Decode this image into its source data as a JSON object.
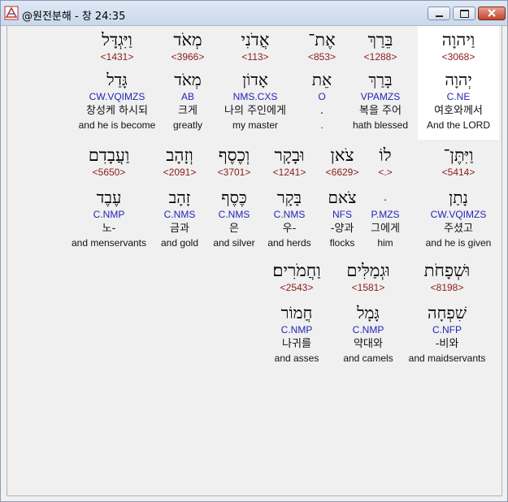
{
  "window": {
    "title": "@원전분해 - 창 24:35"
  },
  "rows": [
    [
      {
        "heb": "וַיהוָה",
        "strong": "<3068>",
        "lemma": "יְהוָה",
        "parse": "C.NE",
        "kor": "여호와께서",
        "eng": "And the LORD",
        "highlight": true
      },
      {
        "heb": "בֵּרַךְ",
        "strong": "<1288>",
        "lemma": "בָּרַךְ",
        "parse": "VPAMZS",
        "kor": "복을 주어",
        "eng": "hath blessed"
      },
      {
        "heb": "אֶת־",
        "strong": "<853>",
        "lemma": "אֵת",
        "parse": "O",
        "kor": ".",
        "eng": "."
      },
      {
        "heb": "אֲדֹנִי",
        "strong": "<113>",
        "lemma": "אָדוֹן",
        "parse": "NMS.CXS",
        "kor": "나의 주인에게",
        "eng": "my master"
      },
      {
        "heb": "מְאֹד",
        "strong": "<3966>",
        "lemma": "מְאֹד",
        "parse": "AB",
        "kor": "크게",
        "eng": "greatly"
      },
      {
        "heb": "וַיִּגְדָּל",
        "strong": "<1431>",
        "lemma": "גָּדַל",
        "parse": "CW.VQIMZS",
        "kor": "창성케 하시되",
        "eng": "and he is become"
      }
    ],
    [
      {
        "heb": "וַיִּתֶּן־",
        "strong": "<5414>",
        "lemma": "נָתַן",
        "parse": "CW.VQIMZS",
        "kor": "주셨고",
        "eng": "and he is given"
      },
      {
        "heb": "לוֹ",
        "strong": "<.>",
        "lemma": ".",
        "parse": "P.MZS",
        "kor": "그에게",
        "eng": "him"
      },
      {
        "heb": "צֹאן",
        "strong": "<6629>",
        "lemma": "צֹאם",
        "parse": "NFS",
        "kor": "-양과",
        "eng": "flocks"
      },
      {
        "heb": "וּבָקָר",
        "strong": "<1241>",
        "lemma": "בָּקָר",
        "parse": "C.NMS",
        "kor": "우-",
        "eng": "and herds"
      },
      {
        "heb": "וְכֶסֶף",
        "strong": "<3701>",
        "lemma": "כֶּסֶף",
        "parse": "C.NMS",
        "kor": "은",
        "eng": "and silver"
      },
      {
        "heb": "וְזָהָב",
        "strong": "<2091>",
        "lemma": "זָהָב",
        "parse": "C.NMS",
        "kor": "금과",
        "eng": "and gold"
      },
      {
        "heb": "וַעֲבָדִם",
        "strong": "<5650>",
        "lemma": "עֶבֶד",
        "parse": "C.NMP",
        "kor": "노-",
        "eng": "and menservants"
      }
    ],
    [
      {
        "heb": "וּשְׁפָחֹת",
        "strong": "<8198>",
        "lemma": "שִׁפְחָה",
        "parse": "C.NFP",
        "kor": "-비와",
        "eng": "and maidservants"
      },
      {
        "heb": "וּגְמַלִּים",
        "strong": "<1581>",
        "lemma": "גָּמָל",
        "parse": "C.NMP",
        "kor": "약대와",
        "eng": "and camels"
      },
      {
        "heb": "וַחֲמֹרִים׃",
        "strong": "<2543>",
        "lemma": "חֲמוֹר",
        "parse": "C.NMP",
        "kor": "나귀를",
        "eng": "and asses"
      }
    ]
  ]
}
